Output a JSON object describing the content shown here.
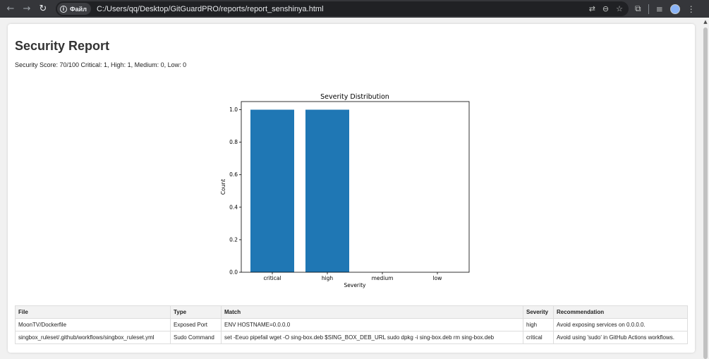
{
  "browser": {
    "site_chip_label": "Файл",
    "url": "C:/Users/qq/Desktop/GitGuardPRO/reports/report_senshinya.html"
  },
  "report": {
    "title": "Security Report",
    "summary": "Security Score: 70/100 Critical: 1, High: 1, Medium: 0, Low: 0"
  },
  "chart_data": {
    "type": "bar",
    "title": "Severity Distribution",
    "xlabel": "Severity",
    "ylabel": "Count",
    "categories": [
      "critical",
      "high",
      "medium",
      "low"
    ],
    "values": [
      1,
      1,
      0,
      0
    ],
    "ylim": [
      0,
      1.05
    ],
    "yticks": [
      "0.0",
      "0.2",
      "0.4",
      "0.6",
      "0.8",
      "1.0"
    ],
    "grid": false,
    "bar_color": "#1f77b4"
  },
  "table": {
    "headers": [
      "File",
      "Type",
      "Match",
      "Severity",
      "Recommendation"
    ],
    "rows": [
      [
        "MoonTV/Dockerfile",
        "Exposed Port",
        "ENV HOSTNAME=0.0.0.0",
        "high",
        "Avoid exposing services on 0.0.0.0."
      ],
      [
        "singbox_ruleset/.github/workflows/singbox_ruleset.yml",
        "Sudo Command",
        "set -Eeuo pipefail wget -O sing-box.deb $SING_BOX_DEB_URL sudo dpkg -i sing-box.deb rm sing-box.deb",
        "critical",
        "Avoid using 'sudo' in GitHub Actions workflows."
      ]
    ]
  }
}
